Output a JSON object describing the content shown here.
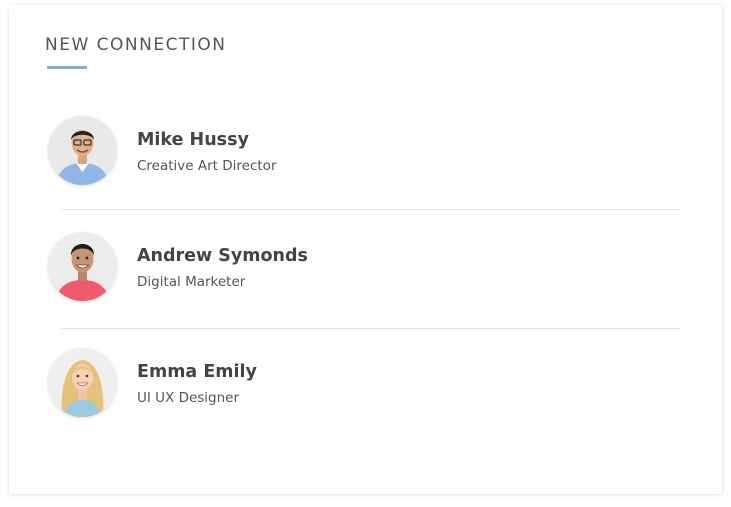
{
  "panel": {
    "title": "NEW CONNECTION",
    "accent_color": "#7fb0d8"
  },
  "connections": [
    {
      "name": "Mike Hussy",
      "role": "Creative Art Director",
      "avatar_icon": "person-photo-icon"
    },
    {
      "name": "Andrew Symonds",
      "role": "Digital Marketer",
      "avatar_icon": "person-photo-icon"
    },
    {
      "name": "Emma Emily",
      "role": "UI UX Designer",
      "avatar_icon": "person-photo-icon"
    }
  ]
}
